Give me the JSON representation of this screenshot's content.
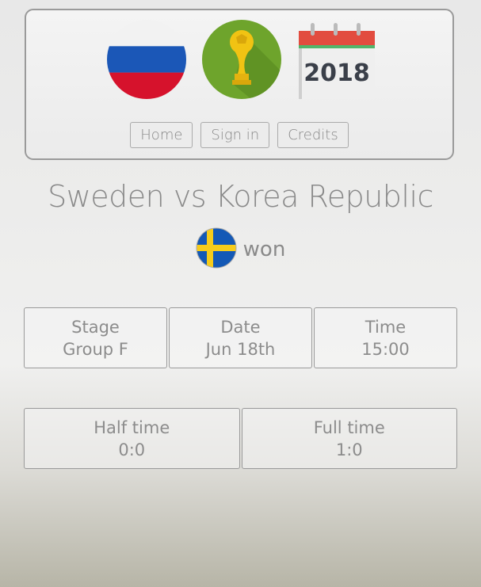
{
  "header": {
    "icons": [
      "russia-flag-icon",
      "trophy-icon",
      "calendar-icon"
    ],
    "calendar_year": "2018",
    "nav": [
      {
        "label": "Home"
      },
      {
        "label": "Sign in"
      },
      {
        "label": "Credits"
      }
    ]
  },
  "match": {
    "title": "Sweden vs Korea Republic",
    "winner_flag": "sweden-flag-icon",
    "result_text": "won"
  },
  "info": {
    "stage": {
      "label": "Stage",
      "value": "Group F"
    },
    "date": {
      "label": "Date",
      "value": "Jun 18th"
    },
    "time": {
      "label": "Time",
      "value": "15:00"
    },
    "half_time": {
      "label": "Half time",
      "value": "0:0"
    },
    "full_time": {
      "label": "Full time",
      "value": "1:0"
    }
  },
  "colors": {
    "russia": [
      "#f2f2f2",
      "#1b57b7",
      "#d6122c"
    ],
    "trophy_bg": "#6ea42c",
    "trophy_gold": "#f1c313",
    "calendar_red": "#e24c3f",
    "calendar_green": "#51b56a",
    "sweden_blue": "#1459b6",
    "sweden_yellow": "#f6cc1b"
  }
}
